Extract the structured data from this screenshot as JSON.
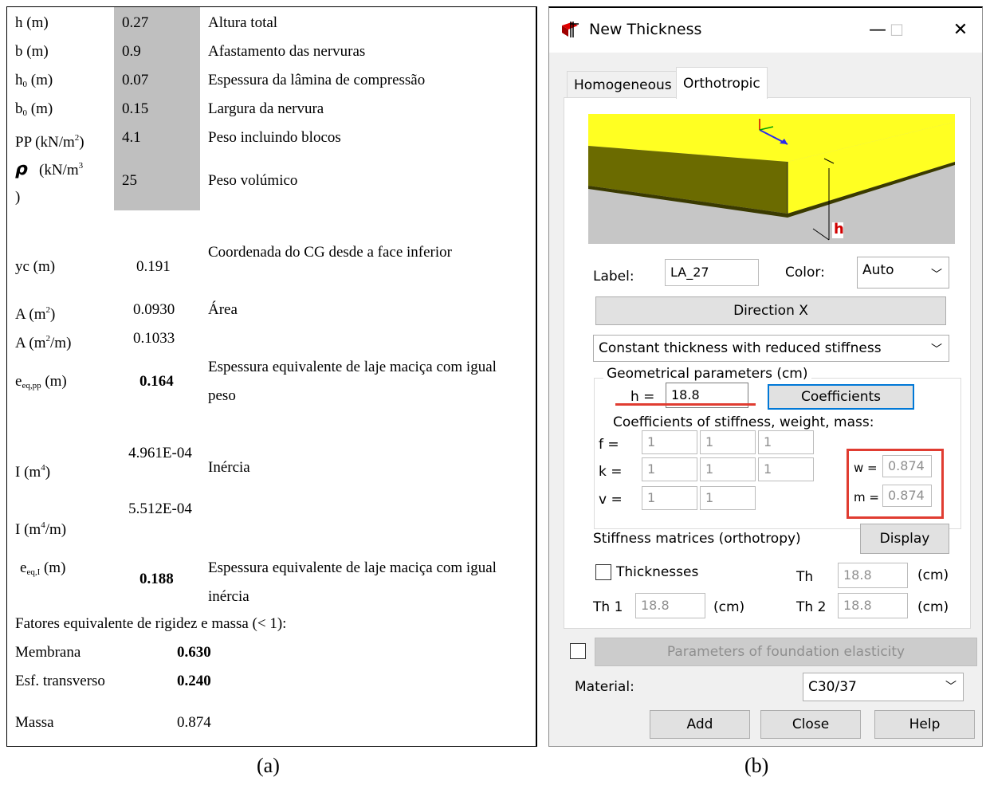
{
  "panel_a": {
    "rows_top": [
      {
        "label": "h (m)",
        "value": "0.27",
        "desc": "Altura total"
      },
      {
        "label": "b (m)",
        "value": "0.9",
        "desc": "Afastamento das nervuras"
      },
      {
        "label_main": "h",
        "label_sub": "0",
        "label_tail": " (m)",
        "value": "0.07",
        "desc": "Espessura da lâmina de compressão"
      },
      {
        "label_main": "b",
        "label_sub": "0",
        "label_tail": " (m)",
        "value": "0.15",
        "desc": "Largura da nervura"
      },
      {
        "label_main": "PP (kN/m",
        "label_sup": "2",
        "label_tail": ")",
        "value": "4.1",
        "desc": "Peso incluindo blocos"
      },
      {
        "label_sym": "ρ",
        "label_main": "(kN/m",
        "label_sup": "3",
        "label_tail": ")",
        "value": "25",
        "desc": "Peso volúmico"
      }
    ],
    "yc": {
      "label": "yc (m)",
      "value": "0.191",
      "desc": "Coordenada do CG desde a face inferior"
    },
    "area": {
      "label_main": "A (m",
      "label_sup": "2",
      "label_tail": ")",
      "value": "0.0930",
      "desc": "Área"
    },
    "area_m": {
      "label_main": "A (m",
      "label_sup": "2",
      "label_tail": "/m)",
      "value": "0.1033"
    },
    "eq_pp": {
      "label_main": "e",
      "label_sub": "eq,pp",
      "label_tail": " (m)",
      "value": "0.164",
      "desc": "Espessura equivalente de laje maciça com igual peso"
    },
    "inertia": {
      "label_main": "I (m",
      "label_sup": "4",
      "label_tail": ")",
      "value": "4.961E-04",
      "desc": "Inércia"
    },
    "inertia_m": {
      "label_main": "I (m",
      "label_sup": "4",
      "label_tail": "/m)",
      "value": "5.512E-04"
    },
    "eq_i": {
      "label_main": "e",
      "label_sub": "eq,I",
      "label_tail": " (m)",
      "value": "0.188",
      "desc": "Espessura equivalente de laje maciça com igual inércia"
    },
    "factors_title": "Fatores equivalente de rigidez e massa (< 1):",
    "membrana": {
      "label": "Membrana",
      "value": "0.630"
    },
    "esf": {
      "label": "Esf. transverso",
      "value": "0.240"
    },
    "massa": {
      "label": "Massa",
      "value": "0.874"
    }
  },
  "captions": {
    "a": "(a)",
    "b": "(b)"
  },
  "dialog": {
    "title": "New Thickness",
    "window_buttons": {
      "minimize": "—",
      "maximize": "☐",
      "close": "✕"
    },
    "tabs": [
      "Homogeneous",
      "Orthotropic"
    ],
    "active_tab": "Orthotropic",
    "preview_dimension_label": "h",
    "label_field": {
      "label": "Label:",
      "value": "LA_27"
    },
    "color_field": {
      "label": "Color:",
      "value": "Auto"
    },
    "direction_button": "Direction X",
    "thickness_type": "Constant thickness with reduced stiffness",
    "geom_group_label": "Geometrical parameters (cm)",
    "h_field": {
      "label": "h  =",
      "value": "18.8"
    },
    "coefficients_button": "Coefficients",
    "coeff_label": "Coefficients of stiffness, weight, mass:",
    "coeff_rows": [
      {
        "label": "f =",
        "values": [
          "1",
          "1",
          "1"
        ]
      },
      {
        "label": "k =",
        "values": [
          "1",
          "1",
          "1"
        ]
      },
      {
        "label": "v =",
        "values": [
          "1",
          "1"
        ]
      }
    ],
    "w_field": {
      "label": "w =",
      "value": "0.874"
    },
    "m_field": {
      "label": "m =",
      "value": "0.874"
    },
    "stiffness_label": "Stiffness matrices (orthotropy)",
    "display_button": "Display",
    "thicknesses_checkbox": "Thicknesses",
    "th": {
      "label": "Th",
      "value": "18.8",
      "unit": "(cm)"
    },
    "th1": {
      "label": "Th 1",
      "value": "18.8",
      "unit": "(cm)"
    },
    "th2": {
      "label": "Th 2",
      "value": "18.8",
      "unit": "(cm)"
    },
    "foundation_button": "Parameters of foundation elasticity",
    "material": {
      "label": "Material:",
      "value": "C30/37"
    },
    "buttons": {
      "add": "Add",
      "close": "Close",
      "help": "Help"
    },
    "colors": {
      "highlight": "#e03c31",
      "slab_top": "#ffff22",
      "slab_side": "#6b6b00",
      "focus": "#0078d7"
    }
  }
}
